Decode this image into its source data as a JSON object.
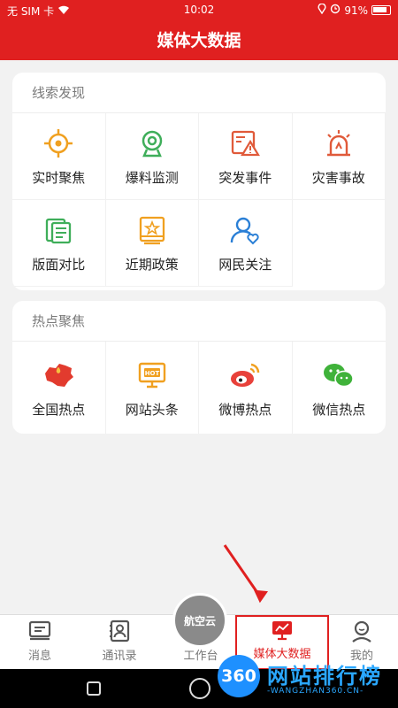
{
  "status_bar": {
    "carrier": "无 SIM 卡",
    "time": "10:02",
    "battery": "91%"
  },
  "title": "媒体大数据",
  "sections": [
    {
      "title": "线索发现",
      "items": [
        {
          "label": "实时聚焦",
          "icon": "crosshair-icon"
        },
        {
          "label": "爆料监测",
          "icon": "camera-monitor-icon"
        },
        {
          "label": "突发事件",
          "icon": "alert-document-icon"
        },
        {
          "label": "灾害事故",
          "icon": "siren-icon"
        },
        {
          "label": "版面对比",
          "icon": "pages-icon"
        },
        {
          "label": "近期政策",
          "icon": "policy-book-icon"
        },
        {
          "label": "网民关注",
          "icon": "user-heart-icon"
        }
      ]
    },
    {
      "title": "热点聚焦",
      "items": [
        {
          "label": "全国热点",
          "icon": "china-map-icon"
        },
        {
          "label": "网站头条",
          "icon": "hot-screen-icon"
        },
        {
          "label": "微博热点",
          "icon": "weibo-icon"
        },
        {
          "label": "微信热点",
          "icon": "wechat-icon"
        }
      ]
    }
  ],
  "tabs": [
    {
      "label": "消息",
      "icon": "message-icon"
    },
    {
      "label": "通讯录",
      "icon": "contacts-icon"
    },
    {
      "label": "工作台",
      "icon": "cloud-badge-icon",
      "badge": "航空云"
    },
    {
      "label": "媒体大数据",
      "icon": "monitor-chart-icon",
      "active": true
    },
    {
      "label": "我的",
      "icon": "user-icon"
    }
  ],
  "watermark": {
    "badge": "360",
    "text": "网站排行榜",
    "sub": "-WANGZHAN360.CN-"
  },
  "colors": {
    "brand": "#e02020",
    "icon_orange": "#f0a020",
    "icon_green": "#3fae5a",
    "icon_blue": "#2a7fd6",
    "watermark_blue": "#2aa7ff"
  }
}
